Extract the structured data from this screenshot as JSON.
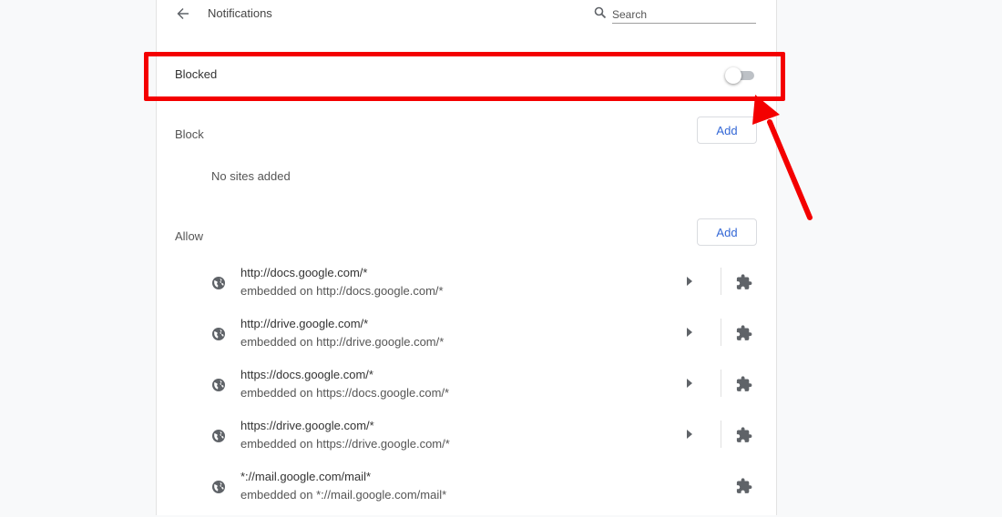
{
  "header": {
    "title": "Notifications",
    "search_placeholder": "Search"
  },
  "blocked_row": {
    "label": "Blocked",
    "toggle_on": false
  },
  "block_section": {
    "title": "Block",
    "add_label": "Add",
    "empty_text": "No sites added"
  },
  "allow_section": {
    "title": "Allow",
    "add_label": "Add",
    "sites": [
      {
        "url": "http://docs.google.com/*",
        "embedded": "embedded on http://docs.google.com/*"
      },
      {
        "url": "http://drive.google.com/*",
        "embedded": "embedded on http://drive.google.com/*"
      },
      {
        "url": "https://docs.google.com/*",
        "embedded": "embedded on https://docs.google.com/*"
      },
      {
        "url": "https://drive.google.com/*",
        "embedded": "embedded on https://drive.google.com/*"
      },
      {
        "url": "*://mail.google.com/mail*",
        "embedded": "embedded on *://mail.google.com/mail*"
      }
    ]
  },
  "colors": {
    "page_bg": "#f8f9fa",
    "accent": "#3367d6",
    "annotation": "#f40000"
  },
  "icons": {
    "back": "arrow-left",
    "search": "magnifier",
    "site": "globe",
    "expand": "triangle-right",
    "extension": "puzzle-piece"
  }
}
